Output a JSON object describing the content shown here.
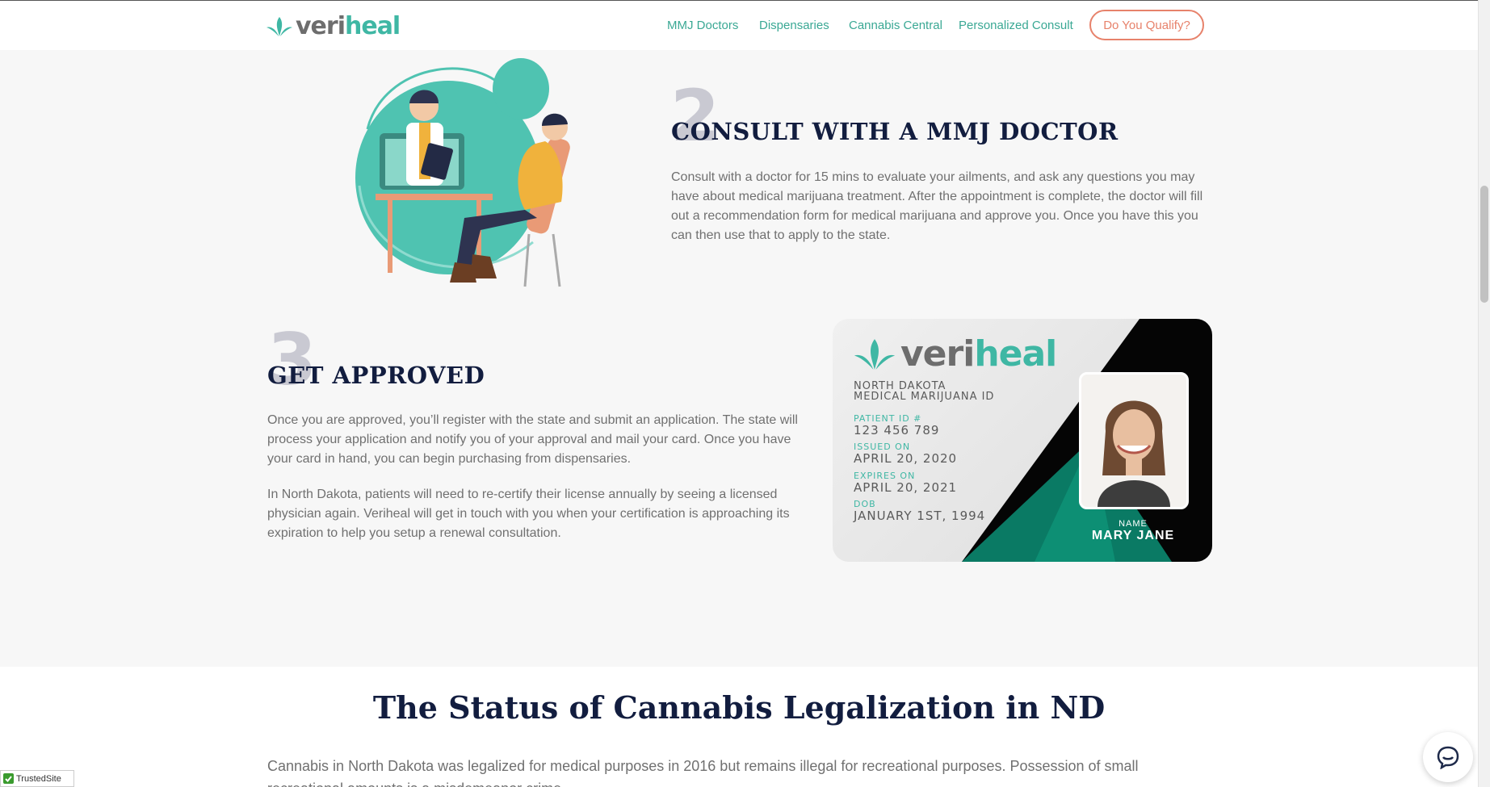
{
  "header": {
    "logo_part1": "veri",
    "logo_part2": "heal",
    "nav": [
      "MMJ Doctors",
      "Dispensaries",
      "Cannabis Central",
      "Personalized Consult"
    ],
    "cta": "Do You Qualify?"
  },
  "step2": {
    "number": "2",
    "title": "CONSULT WITH A MMJ DOCTOR",
    "body": "Consult with a doctor for 15 mins to evaluate your ailments, and ask any questions you may have about medical marijuana treatment. After the appointment is complete, the doctor will fill out a recommendation form for medical marijuana and approve you. Once you have this you can then use that to apply to the state."
  },
  "step3": {
    "number": "3",
    "title": "GET APPROVED",
    "body1": "Once you are approved, you’ll register with the state and submit an application. The state will process your application and notify you of your approval and mail your card. Once you have your card in hand, you can begin purchasing from dispensaries.",
    "body2": "In North Dakota, patients will need to re-certify their license annually by seeing a licensed physician again. Veriheal will get in touch with you when your certification is approaching its expiration to help you setup a renewal consultation."
  },
  "card": {
    "logo_part1": "veri",
    "logo_part2": "heal",
    "state": "NORTH DAKOTA",
    "type": "MEDICAL MARIJUANA ID",
    "patient_id_label": "PATIENT ID #",
    "patient_id": "123 456 789",
    "issued_label": "ISSUED ON",
    "issued": "APRIL 20, 2020",
    "expires_label": "EXPIRES ON",
    "expires": "APRIL 20, 2021",
    "dob_label": "DOB",
    "dob": "JANUARY 1ST, 1994",
    "name_label": "NAME",
    "name": "MARY JANE"
  },
  "status": {
    "heading": "The Status of Cannabis Legalization in ND",
    "body": "Cannabis in North Dakota was legalized for medical purposes in 2016 but remains illegal for recreational purposes. Possession of small recreational amounts is a misdemeanor crime."
  },
  "badges": {
    "trusted": "TrustedSite"
  },
  "colors": {
    "brand_teal": "#3fb7a4",
    "accent_coral": "#e7826b",
    "heading_navy": "#121d3f"
  }
}
